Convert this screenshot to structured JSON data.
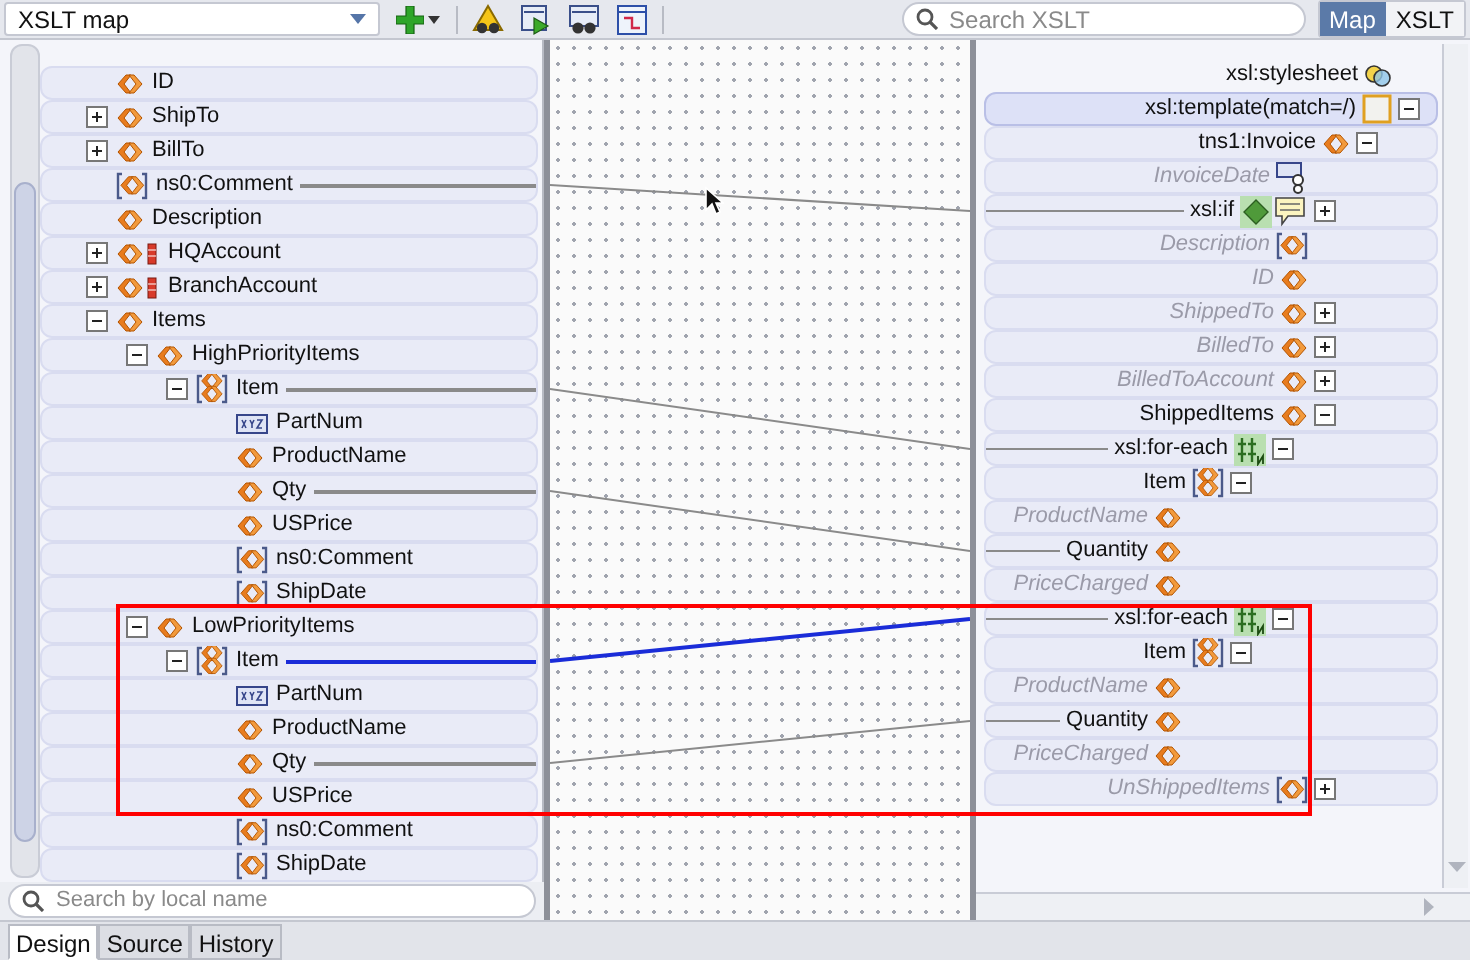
{
  "toolbar": {
    "map_select": "XSLT map",
    "search_placeholder": "Search XSLT",
    "view_toggle": [
      {
        "label": "Map",
        "selected": true
      },
      {
        "label": "XSLT",
        "selected": false
      }
    ]
  },
  "source_tree": [
    {
      "label": "ID",
      "kind": "element"
    },
    {
      "label": "ShipTo",
      "kind": "element",
      "expanded": false
    },
    {
      "label": "BillTo",
      "kind": "element",
      "expanded": false
    },
    {
      "label": "ns0:Comment",
      "kind": "optional",
      "link": {
        "selected": false
      }
    },
    {
      "label": "Description",
      "kind": "element"
    },
    {
      "label": "HQAccount",
      "kind": "choice",
      "expanded": false
    },
    {
      "label": "BranchAccount",
      "kind": "choice",
      "expanded": false
    },
    {
      "label": "Items",
      "kind": "element",
      "expanded": true,
      "children": [
        {
          "label": "HighPriorityItems",
          "kind": "element",
          "expanded": true,
          "children": [
            {
              "label": "Item",
              "kind": "repeating",
              "expanded": true,
              "link": {
                "selected": false
              },
              "children": [
                {
                  "label": "PartNum",
                  "kind": "text"
                },
                {
                  "label": "ProductName",
                  "kind": "element"
                },
                {
                  "label": "Qty",
                  "kind": "element",
                  "link": {
                    "selected": false
                  }
                },
                {
                  "label": "USPrice",
                  "kind": "element"
                },
                {
                  "label": "ns0:Comment",
                  "kind": "optional"
                },
                {
                  "label": "ShipDate",
                  "kind": "optional"
                }
              ]
            }
          ]
        },
        {
          "label": "LowPriorityItems",
          "kind": "element",
          "expanded": true,
          "children": [
            {
              "label": "Item",
              "kind": "repeating",
              "expanded": true,
              "link": {
                "selected": true
              },
              "children": [
                {
                  "label": "PartNum",
                  "kind": "text"
                },
                {
                  "label": "ProductName",
                  "kind": "element"
                },
                {
                  "label": "Qty",
                  "kind": "element",
                  "link": {
                    "selected": false
                  }
                },
                {
                  "label": "USPrice",
                  "kind": "element"
                },
                {
                  "label": "ns0:Comment",
                  "kind": "optional"
                },
                {
                  "label": "ShipDate",
                  "kind": "optional"
                }
              ]
            }
          ]
        }
      ]
    }
  ],
  "source_search_placeholder": "Search by local name",
  "target_tree": [
    {
      "label": "xsl:stylesheet",
      "kind": "stylesheet",
      "mapped": true,
      "children": [
        {
          "label": "xsl:template(match=/)",
          "kind": "template",
          "mapped": true,
          "expanded": true,
          "children": [
            {
              "label": "tns1:Invoice",
              "kind": "element",
              "mapped": true,
              "expanded": true,
              "children": [
                {
                  "label": "InvoiceDate",
                  "kind": "attribute",
                  "mapped": false
                },
                {
                  "label": "xsl:if",
                  "kind": "if",
                  "mapped": true,
                  "linked": true,
                  "expanded": false
                },
                {
                  "label": "Description",
                  "kind": "optional",
                  "mapped": false
                },
                {
                  "label": "ID",
                  "kind": "element",
                  "mapped": false
                },
                {
                  "label": "ShippedTo",
                  "kind": "element",
                  "mapped": false,
                  "expanded": false
                },
                {
                  "label": "BilledTo",
                  "kind": "element",
                  "mapped": false,
                  "expanded": false
                },
                {
                  "label": "BilledToAccount",
                  "kind": "element",
                  "mapped": false,
                  "expanded": false
                },
                {
                  "label": "ShippedItems",
                  "kind": "element",
                  "mapped": true,
                  "expanded": true,
                  "children": [
                    {
                      "label": "xsl:for-each",
                      "kind": "for-each",
                      "mapped": true,
                      "linked": true,
                      "expanded": true,
                      "children": [
                        {
                          "label": "Item",
                          "kind": "repeating",
                          "mapped": true,
                          "expanded": true,
                          "children": [
                            {
                              "label": "ProductName",
                              "kind": "element",
                              "mapped": false
                            },
                            {
                              "label": "Quantity",
                              "kind": "element",
                              "mapped": true,
                              "linked": true
                            },
                            {
                              "label": "PriceCharged",
                              "kind": "element",
                              "mapped": false
                            }
                          ]
                        }
                      ]
                    },
                    {
                      "label": "xsl:for-each",
                      "kind": "for-each",
                      "mapped": true,
                      "linked": true,
                      "expanded": true,
                      "children": [
                        {
                          "label": "Item",
                          "kind": "repeating",
                          "mapped": true,
                          "expanded": true,
                          "children": [
                            {
                              "label": "ProductName",
                              "kind": "element",
                              "mapped": false
                            },
                            {
                              "label": "Quantity",
                              "kind": "element",
                              "mapped": true,
                              "linked": true
                            },
                            {
                              "label": "PriceCharged",
                              "kind": "element",
                              "mapped": false
                            }
                          ]
                        }
                      ]
                    }
                  ]
                },
                {
                  "label": "UnShippedItems",
                  "kind": "optional",
                  "mapped": false,
                  "expanded": false
                }
              ]
            }
          ]
        }
      ]
    }
  ],
  "bottom_tabs": [
    {
      "label": "Design",
      "selected": true
    },
    {
      "label": "Source",
      "selected": false
    },
    {
      "label": "History",
      "selected": false
    }
  ]
}
